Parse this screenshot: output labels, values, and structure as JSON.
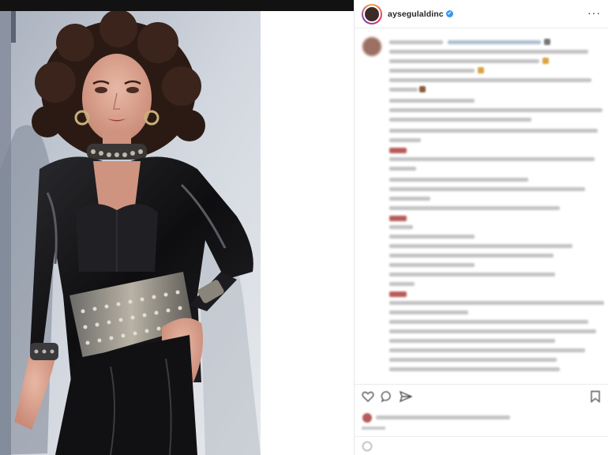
{
  "post": {
    "username": "aysegulaldinc",
    "verified_mark": "✔",
    "more_label": "···"
  },
  "icons": {
    "avatar": "avatar",
    "verified": "verified-badge-icon",
    "more": "more-options-icon",
    "like": "heart-icon",
    "comment": "comment-icon",
    "share": "paper-plane-icon",
    "save": "bookmark-icon",
    "emoji": "smiley-icon"
  },
  "colors": {
    "username": "#262626",
    "verified": "#3897f0",
    "blurred_text": "#b9b9b9",
    "blurred_highlight": "#b85a5a"
  }
}
